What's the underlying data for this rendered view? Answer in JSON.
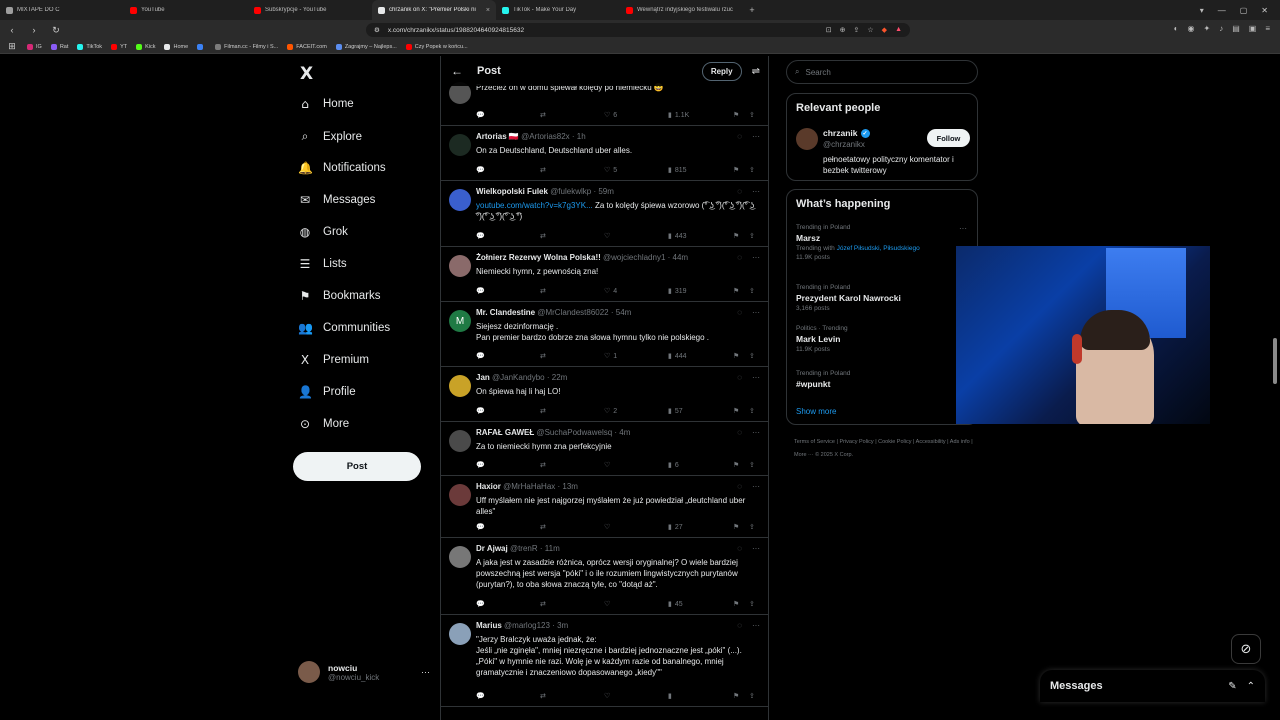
{
  "browser": {
    "tabs": [
      {
        "title": "MIXTAPE DO C",
        "color": "#9e9e9e",
        "active": false
      },
      {
        "title": "YouTube",
        "color": "#ff0000",
        "active": false
      },
      {
        "title": "Subskrypcje - YouTube",
        "color": "#ff0000",
        "active": false
      },
      {
        "title": "chrzanik on X: \"Premier Polski ni",
        "color": "#e7e9ea",
        "active": true
      },
      {
        "title": "TikTok - Make Your Day",
        "color": "#25f4ee",
        "active": false
      },
      {
        "title": "Wewnątrz indyjskiego festiwalu rzuc",
        "color": "#ff0000",
        "active": false
      }
    ],
    "url": "x.com/chrzanikx/status/1988204640924815632",
    "bookmarks": [
      {
        "label": "IG",
        "color": "#d62976"
      },
      {
        "label": "Rat",
        "color": "#8a5cf6"
      },
      {
        "label": "TikTok",
        "color": "#25f4ee"
      },
      {
        "label": "YT",
        "color": "#ff0000"
      },
      {
        "label": "Kick",
        "color": "#53fc18"
      },
      {
        "label": "Home",
        "color": "#e7e9ea"
      },
      {
        "label": "",
        "color": "#3b82f6"
      },
      {
        "label": "Filman.cc - Filmy i S...",
        "color": "#7c7c7c"
      },
      {
        "label": "FACEIT.com",
        "color": "#ff5500"
      },
      {
        "label": "Zagrajmy – Najleps...",
        "color": "#5b8def"
      },
      {
        "label": "Czy Popek w końcu...",
        "color": "#ff0000"
      }
    ]
  },
  "nav": {
    "logo": "X",
    "items": [
      {
        "label": "Home",
        "icon": "⌂",
        "name": "home"
      },
      {
        "label": "Explore",
        "icon": "⌕",
        "name": "explore"
      },
      {
        "label": "Notifications",
        "icon": "🔔",
        "name": "notifications"
      },
      {
        "label": "Messages",
        "icon": "✉",
        "name": "messages"
      },
      {
        "label": "Grok",
        "icon": "◍",
        "name": "grok"
      },
      {
        "label": "Lists",
        "icon": "☰",
        "name": "lists"
      },
      {
        "label": "Bookmarks",
        "icon": "⚑",
        "name": "bookmarks"
      },
      {
        "label": "Communities",
        "icon": "👥",
        "name": "communities"
      },
      {
        "label": "Premium",
        "icon": "X",
        "name": "premium"
      },
      {
        "label": "Profile",
        "icon": "👤",
        "name": "profile"
      },
      {
        "label": "More",
        "icon": "⊙",
        "name": "more"
      }
    ],
    "post_button": "Post",
    "account": {
      "name": "nowciu",
      "handle": "@nowciu_kick"
    }
  },
  "main": {
    "title": "Post",
    "reply_button": "Reply",
    "replies": [
      {
        "name": "",
        "handle": "",
        "time": "",
        "text": "Przecież on w domu śpiewał kolędy po niemiecku 😄",
        "replies": "",
        "retweets": "",
        "likes": "6",
        "views": "1.1K",
        "avatar": "#555"
      },
      {
        "name": "Artorias 🇵🇱",
        "handle": "@Artorias82x",
        "time": "· 1h",
        "text": "On za Deutschland, Deutschland uber alles.",
        "replies": "",
        "retweets": "",
        "likes": "5",
        "views": "815",
        "avatar": "#1c2a22"
      },
      {
        "name": "Wielkopolski Fulek",
        "handle": "@fulekwlkp",
        "time": "· 59m",
        "link": "youtube.com/watch?v=k7g3YK...",
        "text": " Za to kolędy śpiewa wzorowo (͡° ͜ʖ ͡°)(͡° ͜ʖ ͡°)(͡° ͜ʖ ͡°)(͡° ͜ʖ ͡°)(͡° ͜ʖ ͡°)",
        "replies": "",
        "retweets": "",
        "likes": "",
        "views": "443",
        "avatar": "#3a5fcd"
      },
      {
        "name": "Żołnierz Rezerwy Wolna Polska!!",
        "handle": "@wojciechladny1",
        "time": "· 44m",
        "text": "Niemiecki hymn, z pewnością zna!",
        "replies": "",
        "retweets": "",
        "likes": "4",
        "views": "319",
        "avatar": "#8a6a6a"
      },
      {
        "name": "Mr. Clandestine",
        "handle": "@MrClandest86022",
        "time": "· 54m",
        "text": "Siejesz dezinformację .\nPan premier bardzo dobrze zna słowa hymnu tylko nie polskiego .",
        "replies": "",
        "retweets": "",
        "likes": "1",
        "views": "444",
        "avatar": "#1f7a44",
        "initial": "M"
      },
      {
        "name": "Jan",
        "handle": "@JanKandybo",
        "time": "· 22m",
        "text": "On śpiewa haj li haj LO!",
        "replies": "",
        "retweets": "",
        "likes": "2",
        "views": "57",
        "avatar": "#c9a227"
      },
      {
        "name": "RAFAŁ GAWEŁ",
        "handle": "@SuchaPodwawelsq",
        "time": "· 4m",
        "text": "Za to niemiecki hymn zna perfekcyjnie",
        "replies": "",
        "retweets": "",
        "likes": "",
        "views": "6",
        "avatar": "#4a4a4a"
      },
      {
        "name": "Haxior",
        "handle": "@MrHaHaHax",
        "time": "· 13m",
        "text": "Uff myślałem nie jest najgorzej myślałem że już powiedział „deutchland uber alles\"",
        "replies": "",
        "retweets": "",
        "likes": "",
        "views": "27",
        "avatar": "#6b3a3a"
      },
      {
        "name": "Dr Ajwaj",
        "handle": "@trenR",
        "time": "· 11m",
        "text": "A jaka jest w zasadzie różnica, oprócz wersji oryginalnej? O wiele bardziej powszechną jest wersja \"póki\" i o ile rozumiem lingwistycznych purytanów (purytan?), to oba słowa znaczą tyle, co \"dotąd aż\".",
        "replies": "",
        "retweets": "",
        "likes": "",
        "views": "45",
        "avatar": "#777"
      },
      {
        "name": "Marius",
        "handle": "@marlog123",
        "time": "· 3m",
        "text": "\"Jerzy Bralczyk uważa jednak, że:\nJeśli „nie zginęła\", mniej niezręczne i bardziej jednoznaczne jest „póki\" (...).\n„Póki\" w hymnie nie razi. Wolę je w każdym razie od banalnego, mniej gramatycznie i znaczeniowo dopasowanego „kiedy\"\"",
        "replies": "",
        "retweets": "",
        "likes": "",
        "views": "",
        "avatar": "#8aa0b8"
      }
    ]
  },
  "right": {
    "search_placeholder": "Search",
    "relevant": {
      "title": "Relevant people",
      "name": "chrzanik",
      "handle": "@chrzanikx",
      "bio": "pełnoetatowy polityczny komentator i bezbek twitterowy",
      "follow": "Follow"
    },
    "happening": {
      "title": "What’s happening",
      "trends": [
        {
          "context": "Trending in Poland",
          "title": "Marsz",
          "sub_prefix": "Trending with ",
          "sub_link": "Józef Piłsudski, Piłsudskiego",
          "posts": "11.9K posts"
        },
        {
          "context": "Trending in Poland",
          "title": "Prezydent Karol Nawrocki",
          "sub_prefix": "",
          "sub_link": "",
          "posts": "3,166 posts"
        },
        {
          "context": "Politics · Trending",
          "title": "Mark Levin",
          "sub_prefix": "",
          "sub_link": "",
          "posts": "11.9K posts"
        },
        {
          "context": "Trending in Poland",
          "title": "#wpunkt",
          "sub_prefix": "",
          "sub_link": "",
          "posts": ""
        }
      ],
      "show_more": "Show more"
    },
    "footer": "Terms of Service  |  Privacy Policy  |  Cookie Policy  |  Accessibility  |  Ads info  |  More ···  © 2025 X Corp."
  },
  "messages_drawer": "Messages",
  "colors": {
    "accent": "#1d9bf0",
    "bg": "#000000",
    "border": "#2f3336",
    "muted": "#71767b"
  }
}
